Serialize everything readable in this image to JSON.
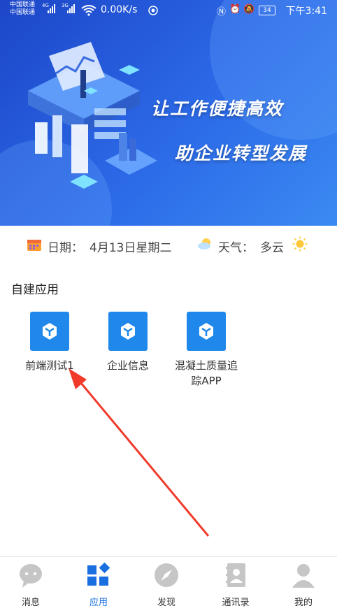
{
  "status_bar": {
    "carrier_1": "中国联通",
    "carrier_2": "中国联通",
    "net_1": "4G",
    "net_2": "3G",
    "net_speed": "0.00K/s",
    "battery": "34",
    "time": "下午3:41"
  },
  "banner": {
    "slogan_1": "让工作便捷高效",
    "slogan_2": "助企业转型发展"
  },
  "info": {
    "date_label": "日期：",
    "date_value": "4月13日星期二",
    "weather_label": "天气：",
    "weather_value": "多云"
  },
  "section": {
    "title": "自建应用"
  },
  "apps": [
    {
      "label": "前端测试1"
    },
    {
      "label": "企业信息"
    },
    {
      "label": "混凝土质量追踪APP"
    }
  ],
  "tabs": [
    {
      "label": "消息"
    },
    {
      "label": "应用"
    },
    {
      "label": "发现"
    },
    {
      "label": "通讯录"
    },
    {
      "label": "我的"
    }
  ],
  "colors": {
    "accent": "#1a6fe0",
    "app_tile": "#1f88ea",
    "banner_start": "#1c46c8",
    "banner_end": "#3b8af2",
    "arrow": "#f03a2a"
  }
}
